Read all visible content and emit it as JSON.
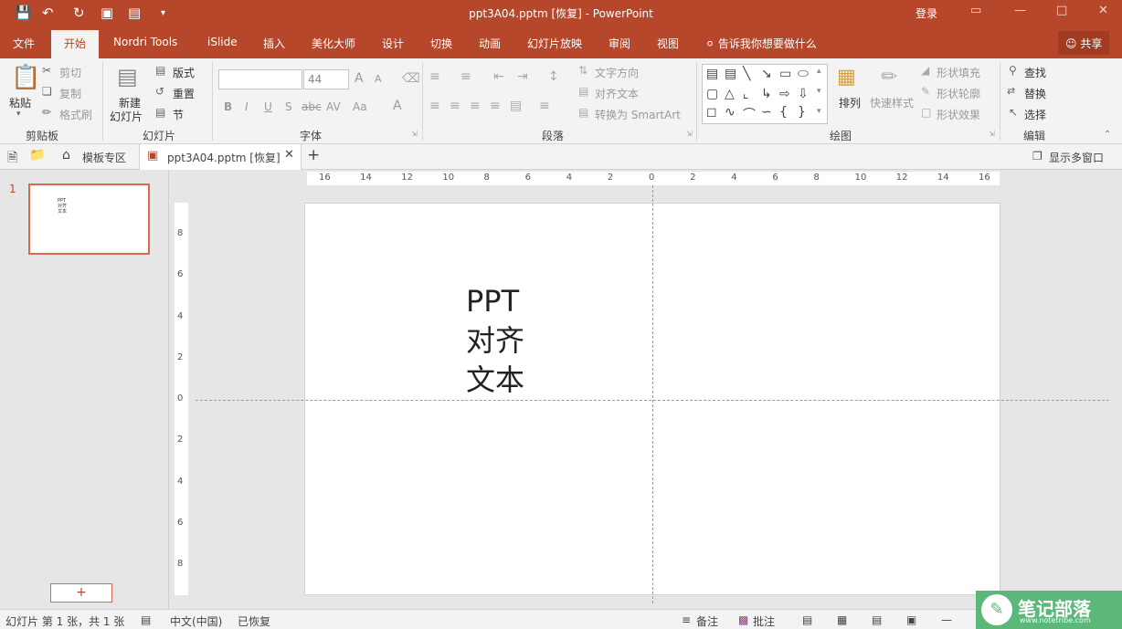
{
  "titlebar": {
    "title": "ppt3A04.pptm [恢复]  -  PowerPoint",
    "login": "登录",
    "icons": [
      "save-icon",
      "undo-icon",
      "redo-icon",
      "present-icon",
      "layout-icon",
      "customize-icon"
    ]
  },
  "tabs": [
    "文件",
    "开始",
    "Nordri Tools",
    "iSlide",
    "插入",
    "美化大师",
    "设计",
    "切换",
    "动画",
    "幻灯片放映",
    "审阅",
    "视图"
  ],
  "tell_me": "告诉我你想要做什么",
  "share": "共享",
  "ribbon": {
    "clipboard": {
      "paste": "粘贴",
      "cut": "剪切",
      "copy": "复制",
      "format_painter": "格式刷",
      "label": "剪贴板"
    },
    "slides": {
      "new_slide_1": "新建",
      "new_slide_2": "幻灯片",
      "layout": "版式",
      "reset": "重置",
      "section": "节",
      "label": "幻灯片"
    },
    "font": {
      "font_name": "",
      "font_size": "44",
      "bold": "B",
      "italic": "I",
      "underline": "U",
      "strike": "S",
      "shadow": "abc",
      "spacing": "AV",
      "case": "Aa",
      "color": "A",
      "grow": "A",
      "shrink": "A",
      "label": "字体"
    },
    "paragraph": {
      "text_direction": "文字方向",
      "align_text": "对齐文本",
      "smartart": "转换为 SmartArt",
      "label": "段落"
    },
    "drawing": {
      "arrange": "排列",
      "quick_styles": "快速样式",
      "fill": "形状填充",
      "outline": "形状轮廓",
      "effects": "形状效果",
      "label": "绘图"
    },
    "editing": {
      "find": "查找",
      "replace": "替换",
      "select": "选择",
      "label": "编辑"
    }
  },
  "doctabs": {
    "templates": "模板专区",
    "active": "ppt3A04.pptm [恢复]",
    "multi_window": "显示多窗口"
  },
  "thumbnail": {
    "number": "1",
    "text": "PPT\n对齐\n文本"
  },
  "slide": {
    "lines": [
      "PPT",
      "对齐",
      "文本"
    ]
  },
  "hruler": [
    "16",
    "14",
    "12",
    "10",
    "8",
    "6",
    "4",
    "2",
    "0",
    "2",
    "4",
    "6",
    "8",
    "10",
    "12",
    "14",
    "16"
  ],
  "vruler": [
    "8",
    "6",
    "4",
    "2",
    "0",
    "2",
    "4",
    "6",
    "8"
  ],
  "status": {
    "slide_info": "幻灯片 第 1 张，共 1 张",
    "language": "中文(中国)",
    "recovered": "已恢复",
    "notes": "备注",
    "comments": "批注"
  },
  "watermark": {
    "title": "笔记部落",
    "url": "www.notetribe.com"
  },
  "colors": {
    "accent": "#b7472a",
    "ribbon_bg": "#f3f3f3",
    "watermark": "#5cb87a"
  }
}
